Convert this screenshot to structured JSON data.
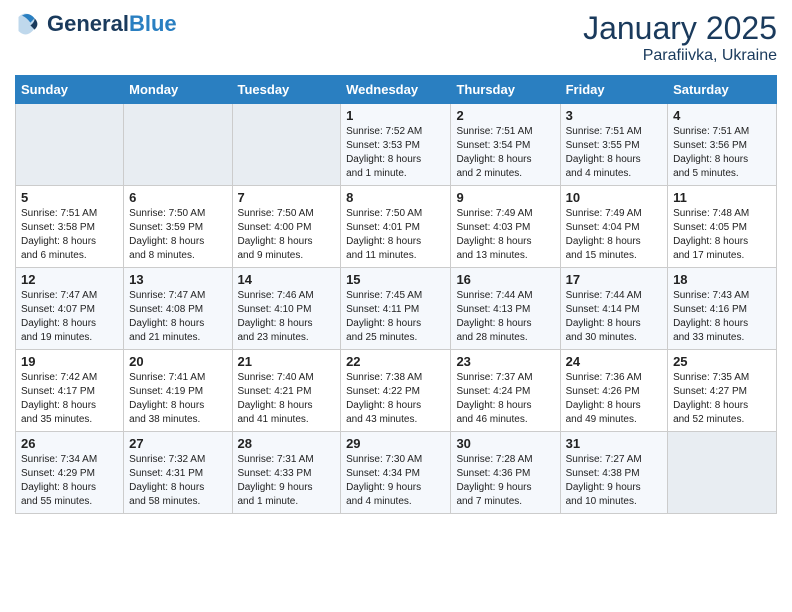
{
  "header": {
    "logo_text_general": "General",
    "logo_text_blue": "Blue",
    "month_title": "January 2025",
    "location": "Parafiivka, Ukraine"
  },
  "weekdays": [
    "Sunday",
    "Monday",
    "Tuesday",
    "Wednesday",
    "Thursday",
    "Friday",
    "Saturday"
  ],
  "weeks": [
    [
      {
        "day": "",
        "info": ""
      },
      {
        "day": "",
        "info": ""
      },
      {
        "day": "",
        "info": ""
      },
      {
        "day": "1",
        "info": "Sunrise: 7:52 AM\nSunset: 3:53 PM\nDaylight: 8 hours\nand 1 minute."
      },
      {
        "day": "2",
        "info": "Sunrise: 7:51 AM\nSunset: 3:54 PM\nDaylight: 8 hours\nand 2 minutes."
      },
      {
        "day": "3",
        "info": "Sunrise: 7:51 AM\nSunset: 3:55 PM\nDaylight: 8 hours\nand 4 minutes."
      },
      {
        "day": "4",
        "info": "Sunrise: 7:51 AM\nSunset: 3:56 PM\nDaylight: 8 hours\nand 5 minutes."
      }
    ],
    [
      {
        "day": "5",
        "info": "Sunrise: 7:51 AM\nSunset: 3:58 PM\nDaylight: 8 hours\nand 6 minutes."
      },
      {
        "day": "6",
        "info": "Sunrise: 7:50 AM\nSunset: 3:59 PM\nDaylight: 8 hours\nand 8 minutes."
      },
      {
        "day": "7",
        "info": "Sunrise: 7:50 AM\nSunset: 4:00 PM\nDaylight: 8 hours\nand 9 minutes."
      },
      {
        "day": "8",
        "info": "Sunrise: 7:50 AM\nSunset: 4:01 PM\nDaylight: 8 hours\nand 11 minutes."
      },
      {
        "day": "9",
        "info": "Sunrise: 7:49 AM\nSunset: 4:03 PM\nDaylight: 8 hours\nand 13 minutes."
      },
      {
        "day": "10",
        "info": "Sunrise: 7:49 AM\nSunset: 4:04 PM\nDaylight: 8 hours\nand 15 minutes."
      },
      {
        "day": "11",
        "info": "Sunrise: 7:48 AM\nSunset: 4:05 PM\nDaylight: 8 hours\nand 17 minutes."
      }
    ],
    [
      {
        "day": "12",
        "info": "Sunrise: 7:47 AM\nSunset: 4:07 PM\nDaylight: 8 hours\nand 19 minutes."
      },
      {
        "day": "13",
        "info": "Sunrise: 7:47 AM\nSunset: 4:08 PM\nDaylight: 8 hours\nand 21 minutes."
      },
      {
        "day": "14",
        "info": "Sunrise: 7:46 AM\nSunset: 4:10 PM\nDaylight: 8 hours\nand 23 minutes."
      },
      {
        "day": "15",
        "info": "Sunrise: 7:45 AM\nSunset: 4:11 PM\nDaylight: 8 hours\nand 25 minutes."
      },
      {
        "day": "16",
        "info": "Sunrise: 7:44 AM\nSunset: 4:13 PM\nDaylight: 8 hours\nand 28 minutes."
      },
      {
        "day": "17",
        "info": "Sunrise: 7:44 AM\nSunset: 4:14 PM\nDaylight: 8 hours\nand 30 minutes."
      },
      {
        "day": "18",
        "info": "Sunrise: 7:43 AM\nSunset: 4:16 PM\nDaylight: 8 hours\nand 33 minutes."
      }
    ],
    [
      {
        "day": "19",
        "info": "Sunrise: 7:42 AM\nSunset: 4:17 PM\nDaylight: 8 hours\nand 35 minutes."
      },
      {
        "day": "20",
        "info": "Sunrise: 7:41 AM\nSunset: 4:19 PM\nDaylight: 8 hours\nand 38 minutes."
      },
      {
        "day": "21",
        "info": "Sunrise: 7:40 AM\nSunset: 4:21 PM\nDaylight: 8 hours\nand 41 minutes."
      },
      {
        "day": "22",
        "info": "Sunrise: 7:38 AM\nSunset: 4:22 PM\nDaylight: 8 hours\nand 43 minutes."
      },
      {
        "day": "23",
        "info": "Sunrise: 7:37 AM\nSunset: 4:24 PM\nDaylight: 8 hours\nand 46 minutes."
      },
      {
        "day": "24",
        "info": "Sunrise: 7:36 AM\nSunset: 4:26 PM\nDaylight: 8 hours\nand 49 minutes."
      },
      {
        "day": "25",
        "info": "Sunrise: 7:35 AM\nSunset: 4:27 PM\nDaylight: 8 hours\nand 52 minutes."
      }
    ],
    [
      {
        "day": "26",
        "info": "Sunrise: 7:34 AM\nSunset: 4:29 PM\nDaylight: 8 hours\nand 55 minutes."
      },
      {
        "day": "27",
        "info": "Sunrise: 7:32 AM\nSunset: 4:31 PM\nDaylight: 8 hours\nand 58 minutes."
      },
      {
        "day": "28",
        "info": "Sunrise: 7:31 AM\nSunset: 4:33 PM\nDaylight: 9 hours\nand 1 minute."
      },
      {
        "day": "29",
        "info": "Sunrise: 7:30 AM\nSunset: 4:34 PM\nDaylight: 9 hours\nand 4 minutes."
      },
      {
        "day": "30",
        "info": "Sunrise: 7:28 AM\nSunset: 4:36 PM\nDaylight: 9 hours\nand 7 minutes."
      },
      {
        "day": "31",
        "info": "Sunrise: 7:27 AM\nSunset: 4:38 PM\nDaylight: 9 hours\nand 10 minutes."
      },
      {
        "day": "",
        "info": ""
      }
    ]
  ]
}
